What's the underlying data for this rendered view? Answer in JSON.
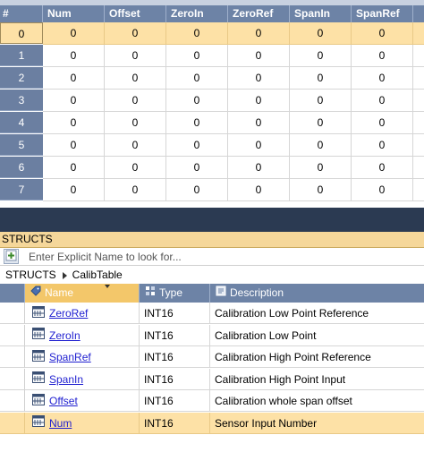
{
  "grid": {
    "corner_label": "#",
    "columns": [
      "Num",
      "Offset",
      "ZeroIn",
      "ZeroRef",
      "SpanIn",
      "SpanRef"
    ],
    "rows": [
      {
        "index": "0",
        "values": [
          "0",
          "0",
          "0",
          "0",
          "0",
          "0"
        ]
      },
      {
        "index": "1",
        "values": [
          "0",
          "0",
          "0",
          "0",
          "0",
          "0"
        ]
      },
      {
        "index": "2",
        "values": [
          "0",
          "0",
          "0",
          "0",
          "0",
          "0"
        ]
      },
      {
        "index": "3",
        "values": [
          "0",
          "0",
          "0",
          "0",
          "0",
          "0"
        ]
      },
      {
        "index": "4",
        "values": [
          "0",
          "0",
          "0",
          "0",
          "0",
          "0"
        ]
      },
      {
        "index": "5",
        "values": [
          "0",
          "0",
          "0",
          "0",
          "0",
          "0"
        ]
      },
      {
        "index": "6",
        "values": [
          "0",
          "0",
          "0",
          "0",
          "0",
          "0"
        ]
      },
      {
        "index": "7",
        "values": [
          "0",
          "0",
          "0",
          "0",
          "0",
          "0"
        ]
      }
    ],
    "selected_row": "0"
  },
  "structs": {
    "panel_title": "STRUCTS",
    "add_icon": "add-icon",
    "search_placeholder": "Enter Explicit Name to look for...",
    "breadcrumb": {
      "root": "STRUCTS",
      "child": "CalibTable"
    },
    "columns": {
      "name": "Name",
      "type": "Type",
      "description": "Description"
    },
    "rows": [
      {
        "name": "ZeroRef",
        "type": "INT16",
        "description": "Calibration Low Point Reference"
      },
      {
        "name": "ZeroIn",
        "type": "INT16",
        "description": "Calibration Low Point"
      },
      {
        "name": "SpanRef",
        "type": "INT16",
        "description": "Calibration High Point Reference"
      },
      {
        "name": "SpanIn",
        "type": "INT16",
        "description": "Calibration High Point Input"
      },
      {
        "name": "Offset",
        "type": "INT16",
        "description": "Calibration whole span offset"
      },
      {
        "name": "Num",
        "type": "INT16",
        "description": "Sensor Input Number"
      }
    ],
    "selected_row": "Num"
  },
  "colors": {
    "header_blue": "#6d83a6",
    "selection": "#fde1a6",
    "panel_title": "#f5d79a",
    "link": "#1f1fd0",
    "dark_band": "#2b3a52"
  }
}
